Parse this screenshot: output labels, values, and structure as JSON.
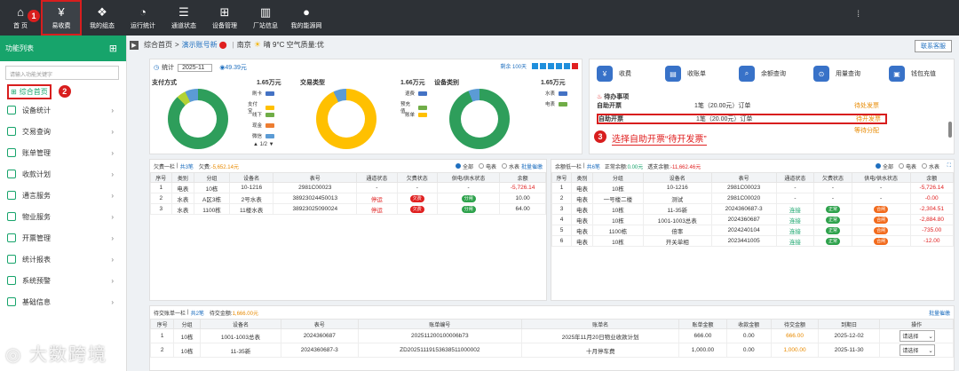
{
  "nav": [
    {
      "label": "首 页",
      "icon": "home-icon"
    },
    {
      "label": "易收费",
      "icon": "yen-pay-icon"
    },
    {
      "label": "我的组态",
      "icon": "cube-icon"
    },
    {
      "label": "运行统计",
      "icon": "pie-stats-icon"
    },
    {
      "label": "通道状态",
      "icon": "sliders-icon"
    },
    {
      "label": "设备管理",
      "icon": "network-icon"
    },
    {
      "label": "厂站信息",
      "icon": "building-icon"
    },
    {
      "label": "我的能源网",
      "icon": "user-icon"
    }
  ],
  "annotations": {
    "a1": "1",
    "a2": "2",
    "a3": "3",
    "callout": "选择自助开票“待开发票”"
  },
  "sidebar": {
    "title": "功能列表",
    "search_placeholder": "请输入功能关键字",
    "home": "综合首页",
    "items": [
      "设备统计",
      "交易查询",
      "账单管理",
      "收款计划",
      "通言服务",
      "物业服务",
      "开票管理",
      "统计报表",
      "系统预警",
      "基础信息"
    ]
  },
  "breadcrumb": {
    "home": "综合首页",
    "sep": ">",
    "link": "演示账号新",
    "city": "南京",
    "weather": "晴 9°C 空气质量:优",
    "contact": "联系客服"
  },
  "stats": {
    "label": "统计",
    "month": "2025-11",
    "amount": "49.39元",
    "remaining": "剩余 100天",
    "charts": [
      {
        "title": "支付方式",
        "total": "1.65万元",
        "legend": [
          "刷卡",
          "支付宝",
          "线下",
          "现金",
          "微信"
        ],
        "legend_colors": [
          "#4472c4",
          "#ffc000",
          "#70ad47",
          "#ed7d31",
          "#5b9bd5"
        ],
        "pager": "1/2"
      },
      {
        "title": "交易类型",
        "total": "1.66万元",
        "legend": [
          "退费",
          "预充值",
          "账单"
        ],
        "legend_colors": [
          "#4472c4",
          "#70ad47",
          "#ffc000"
        ]
      },
      {
        "title": "设备类别",
        "total": "1.65万元",
        "legend": [
          "水表",
          "电表"
        ],
        "legend_colors": [
          "#4472c4",
          "#70ad47"
        ]
      }
    ]
  },
  "quick": [
    "收费",
    "收账单",
    "余额查询",
    "用量查询",
    "钱包充值"
  ],
  "todo": {
    "title": "待办事项",
    "rows": [
      {
        "name": "自助开票",
        "count": "1笔（20.00元）订单",
        "action": "待处发票"
      },
      {
        "name": "自助开票",
        "count": "1笔（20.00元）订单",
        "action": "待开发票"
      },
      {
        "name": "",
        "count": "",
        "action": "等待分配"
      }
    ]
  },
  "arrears": {
    "title": "欠费一栏",
    "sub": "共3笔",
    "amount_label": "欠费:",
    "amount": "-5,652.14元",
    "link": "批量催缴",
    "radios": [
      "全部",
      "电表",
      "水表"
    ],
    "headers": [
      "序号",
      "类别",
      "分组",
      "设备名",
      "表号",
      "通道状态",
      "欠费状态",
      "供电/供水状态",
      "余额"
    ],
    "rows": [
      [
        "1",
        "电表",
        "10栋",
        "10-1216",
        "2981C00023",
        "-",
        "-",
        "-",
        "-5,726.14"
      ],
      [
        "2",
        "水表",
        "A区3栋",
        "2号水表",
        "38923024450013",
        "停运",
        "欠费",
        "分闸",
        "10.00"
      ],
      [
        "3",
        "水表",
        "1100栋",
        "11楼水表",
        "38923025090024",
        "停运",
        "欠费",
        "分闸",
        "64.00"
      ]
    ]
  },
  "balance": {
    "title": "余额低一栏",
    "sub": "共6笔",
    "normal_label": "正常余额:",
    "normal": "0.00元",
    "over_label": "透支余额:",
    "over": "-11,662.46元",
    "radios": [
      "全部",
      "电表",
      "水表"
    ],
    "headers": [
      "序号",
      "类别",
      "分组",
      "设备名",
      "表号",
      "通道状态",
      "欠费状态",
      "供电/供水状态",
      "余额"
    ],
    "rows": [
      [
        "1",
        "电表",
        "10栋",
        "10-1216",
        "2981C00023",
        "-",
        "-",
        "-",
        "-5,726.14"
      ],
      [
        "2",
        "电表",
        "一号楼二楼",
        "测试",
        "2981C00020",
        "-",
        "-",
        "-",
        "-0.00"
      ],
      [
        "3",
        "电表",
        "10栋",
        "11-35新",
        "2024360687-3",
        "连接",
        "正常",
        "合闸",
        "-2,304.51"
      ],
      [
        "4",
        "电表",
        "10栋",
        "1001-1003总表",
        "2024360687",
        "连接",
        "正常",
        "合闸",
        "-2,884.80"
      ],
      [
        "5",
        "电表",
        "1100栋",
        "倍率",
        "2024240104",
        "连接",
        "正常",
        "合闸",
        "-735.00"
      ],
      [
        "6",
        "电表",
        "10栋",
        "开关单相",
        "2023441005",
        "连接",
        "正常",
        "合闸",
        "-12.00"
      ]
    ]
  },
  "unpaid": {
    "title": "待交账单一栏",
    "sub": "共2笔",
    "amount_label": "待交金额:",
    "amount": "1,666.00元",
    "link": "批量催缴",
    "headers": [
      "序号",
      "分组",
      "设备名",
      "表号",
      "账单编号",
      "账单名",
      "账单金额",
      "收款金额",
      "待交金额",
      "到期日",
      "操作"
    ],
    "rows": [
      [
        "1",
        "10栋",
        "1001-1003总表",
        "2024360687",
        "202511200100006b73",
        "2025年11月20日物业收款计划",
        "666.00",
        "0.00",
        "666.00",
        "2025-12-02",
        "请选择"
      ],
      [
        "2",
        "10栋",
        "11-35新",
        "2024360687-3",
        "ZD20251119153638511000002",
        "十月停车费",
        "1,000.00",
        "0.00",
        "1,000.00",
        "2025-11-30",
        "请选择"
      ]
    ]
  },
  "watermark": "大数跨境"
}
